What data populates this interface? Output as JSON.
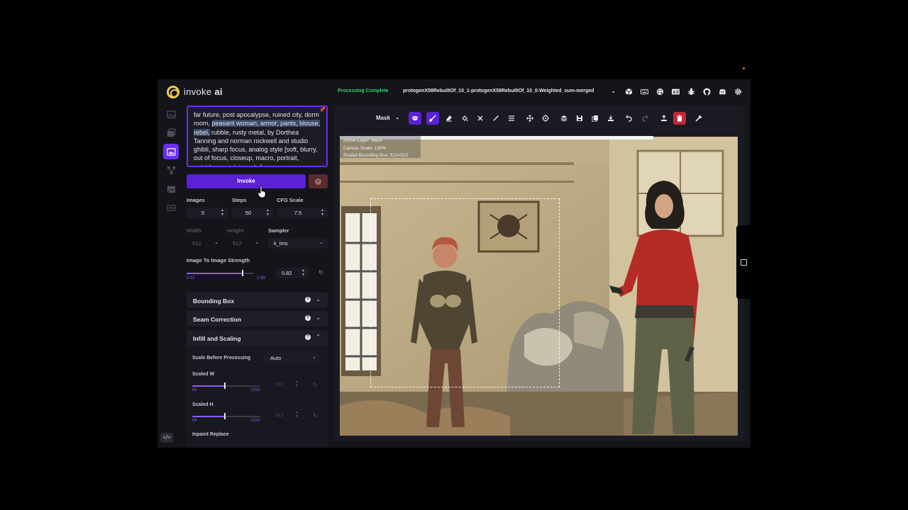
{
  "header": {
    "brand_main": "invoke",
    "brand_accent": "ai",
    "status": "Processing Complete",
    "model": "protogenX58RebuiltOf_10_1-protogenX58RebuiltOf_10_0-Weighted_sum-merged",
    "icons": [
      "model-manager-icon",
      "hotkeys-icon",
      "theme-icon",
      "language-icon",
      "github-icon",
      "bug-report-icon",
      "discord-icon",
      "settings-icon"
    ]
  },
  "rail": {
    "items": [
      "text-to-image",
      "image-to-image",
      "unified-canvas",
      "nodes",
      "postprocessing",
      "training"
    ],
    "active": "unified-canvas"
  },
  "prompt": {
    "before": "far future, post apocalypse, ruined city, dorm room, ",
    "selected": "peasant woman, armor, pants, blouse, rebel,",
    "after": " rubble, rusty metal, by Dorthea Tanning and norman rockwell and studio ghibli, sharp focus, analog style [soft, blurry, out of focus, closeup, macro, portrait, outside, mountains, sky]"
  },
  "invoke_label": "Invoke",
  "params": {
    "images_label": "Images",
    "images": "5",
    "steps_label": "Steps",
    "steps": "50",
    "cfg_label": "CFG Scale",
    "cfg": "7.5",
    "width_label": "Width",
    "width": "512",
    "height_label": "Height",
    "height": "512",
    "sampler_label": "Sampler",
    "sampler": "k_lms"
  },
  "strength": {
    "label": "Image To Image Strength",
    "value": "0.82",
    "min": "0.01",
    "max": "0.99",
    "fraction": 0.82
  },
  "accordions": {
    "bounding_box": "Bounding Box",
    "seam_correction": "Seam Correction",
    "infill_scaling": "Infill and Scaling"
  },
  "infill": {
    "scale_label": "Scale Before Processing",
    "scale_value": "Auto",
    "scaled_w_label": "Scaled W",
    "scaled_w": "512",
    "scaled_h_label": "Scaled H",
    "scaled_h": "512",
    "min": "64",
    "max": "1024",
    "fraction": 0.47,
    "inpaint_replace_label": "Inpaint Replace"
  },
  "canvas": {
    "layer_select": "Mask",
    "info_layer": "Active Layer: Mask",
    "info_scale": "Canvas Scale: 125%",
    "info_bbox": "Scaled Bounding Box: 512×512",
    "toolbar_icons": [
      "mask-options-icon",
      "brush-icon",
      "eraser-icon",
      "fill-bbox-icon",
      "clear-icon",
      "color-picker-icon",
      "brush-options-icon",
      "move-icon",
      "reset-view-icon",
      "merge-layers-icon",
      "save-icon",
      "copy-icon",
      "download-icon",
      "undo-icon",
      "redo-icon",
      "upload-icon",
      "delete-icon",
      "settings-wrench-icon"
    ]
  },
  "colors": {
    "accent": "#5b21d6",
    "status_green": "#2dd36f",
    "danger": "#c0283a"
  }
}
